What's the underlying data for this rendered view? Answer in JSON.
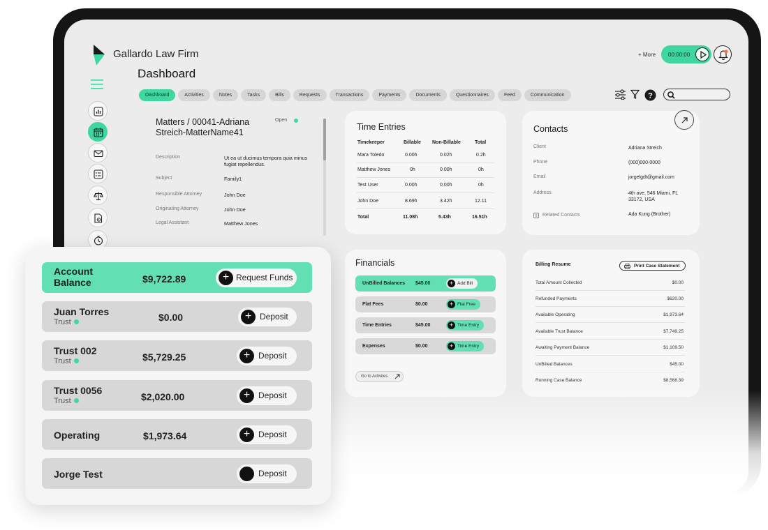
{
  "app": {
    "firm_name": "Gallardo Law Firm",
    "page_title": "Dashboard"
  },
  "header": {
    "more_label": "+ More",
    "timer": "00:00:00"
  },
  "colors": {
    "accent": "#3fd6a0",
    "accent_light": "#63e0b3",
    "device": "#151515"
  },
  "tabs": [
    "Dashboard",
    "Activities",
    "Notes",
    "Tasks",
    "Bills",
    "Requests",
    "Transactions",
    "Payments",
    "Documents",
    "Questionnaires",
    "Feed",
    "Communication"
  ],
  "sidebar_icons": [
    "reports-icon",
    "calendar-icon",
    "mail-icon",
    "checklist-icon",
    "scale-icon",
    "document-settings-icon",
    "clock-icon"
  ],
  "matter": {
    "title": "Matters / 00041-Adriana Streich-MatterName41",
    "status": "Open",
    "rows": [
      {
        "label": "Description",
        "value": "Ut ea ut ducimus tempora quia minus fugiat repellendus."
      },
      {
        "label": "Subject",
        "value": "Family1"
      },
      {
        "label": "Responsible Attorney",
        "value": "John Doe"
      },
      {
        "label": "Originating Attorney",
        "value": "John Doe"
      },
      {
        "label": "Legal Assistant",
        "value": "Matthew Jones"
      }
    ]
  },
  "time_entries": {
    "title": "Time Entries",
    "headers": [
      "Timekeeper",
      "Billable",
      "Non-Billable",
      "Total"
    ],
    "rows": [
      [
        "Mara Toledo",
        "0.00h",
        "0.02h",
        "0.2h"
      ],
      [
        "Matthew Jones",
        "0h",
        "0.00h",
        "0h"
      ],
      [
        "Test User",
        "0.00h",
        "0.00h",
        "0h"
      ],
      [
        "John Doe",
        "8.69h",
        "3.42h",
        "12.11"
      ],
      [
        "Total",
        "11.08h",
        "5.43h",
        "16.51h"
      ]
    ]
  },
  "contacts": {
    "title": "Contacts",
    "rows": [
      {
        "label": "Client",
        "value": "Adriana Streich"
      },
      {
        "label": "Phone",
        "value": "(000)000-0000"
      },
      {
        "label": "Email",
        "value": "jorgelgdt@gmail.com"
      },
      {
        "label": "Address",
        "value": "4th ave, 546 Miami, FL 33172, USA"
      },
      {
        "label": "Related Contacts",
        "value": "Ada Kung (Brother)"
      }
    ]
  },
  "financials": {
    "title": "Financials",
    "rows": [
      {
        "label": "UnBilled Balances",
        "value": "$45.00",
        "action": "Add Bill"
      },
      {
        "label": "Flat Fees",
        "value": "$0.00",
        "action": "Flat Free"
      },
      {
        "label": "Time Entries",
        "value": "$45.00",
        "action": "Time Entry"
      },
      {
        "label": "Expenses",
        "value": "$0.00",
        "action": "Time Entry"
      }
    ],
    "goto_label": "Go to Activites"
  },
  "billing": {
    "title": "Billing Resume",
    "print_label": "Print Case Statement",
    "rows": [
      {
        "label": "Total Amount Collected",
        "value": "$0.00"
      },
      {
        "label": "Refunded Payments",
        "value": "$620.00"
      },
      {
        "label": "Available Operating",
        "value": "$1,973.64"
      },
      {
        "label": "Available Trust Balance",
        "value": "$7,749.25"
      },
      {
        "label": "Awaiting Payment Balance",
        "value": "$1,109.50"
      },
      {
        "label": "UnBilled Balances",
        "value": "$45.00"
      },
      {
        "label": "Running Case Balance",
        "value": "$8,568.39"
      }
    ]
  },
  "accounts": [
    {
      "name": "Account Balance",
      "name_line1": "Account",
      "name_line2": "Balance",
      "amount": "$9,722.89",
      "action": "Request Funds"
    },
    {
      "name": "Juan Torres",
      "sub": "Trust",
      "amount": "$0.00",
      "action": "Deposit"
    },
    {
      "name": "Trust 002",
      "sub": "Trust",
      "amount": "$5,729.25",
      "action": "Deposit"
    },
    {
      "name": "Trust 0056",
      "sub": "Trust",
      "amount": "$2,020.00",
      "action": "Deposit"
    },
    {
      "name": "Operating",
      "amount": "$1,973.64",
      "action": "Deposit"
    },
    {
      "name": "Jorge Test",
      "amount": "",
      "action": "Deposit"
    }
  ]
}
